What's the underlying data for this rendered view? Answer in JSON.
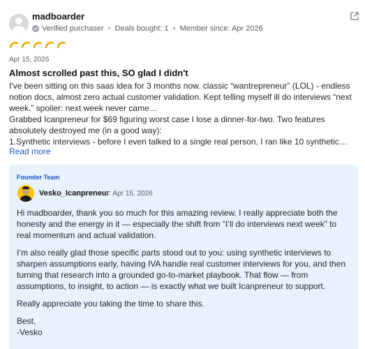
{
  "review": {
    "username": "madboarder",
    "verified_label": "Verified purchaser",
    "deals_bought": "Deals bought: 1",
    "member_since": "Member since: Apr 2026",
    "rating": {
      "value": 5,
      "max": 5,
      "icon": "taco-icon",
      "color": "#f5b800"
    },
    "date": "Apr 15, 2026",
    "title": "Almost scrolled past this, SO glad I didn't",
    "body": [
      "I've been sitting on this saas idea for 3 months now. classic “wantrepreneur” (LOL) - endless notion docs, almost zero actual customer validation. Kept telling myself ill do interviews “next week.” spoiler: next week never came…",
      "Grabbed Icanpreneur for $69 figuring worst case I lose a dinner-for-two. Two features absolutely destroyed me (in a good way):",
      "1.Synthetic interviews - before I even talked to a single real person, I ran like 10 synthetic…"
    ],
    "read_more": "Read more"
  },
  "reply": {
    "label": "Founder Team",
    "name": "Vesko_Icanpreneur",
    "date": "Apr 15, 2026",
    "paragraphs": [
      "Hi madboarder, thank you so much for this amazing review. I really appreciate both the honesty and the energy in it — especially the shift from “I’ll do interviews next week” to real momentum and actual validation.",
      "I’m also really glad those specific parts stood out to you: using synthetic interviews to sharpen assumptions early, having IVA handle real customer interviews for you, and then turning that research into a grounded go-to-market playbook. That flow — from assumptions, to insight, to action — is exactly what we built Icanpreneur to support.",
      "Really appreciate you taking the time to share this."
    ],
    "sign_off": "Best,",
    "signature": "-Vesko"
  },
  "colors": {
    "accent": "#1a56c4",
    "reply_background": "#e8f2fc",
    "rating": "#f5b800"
  }
}
